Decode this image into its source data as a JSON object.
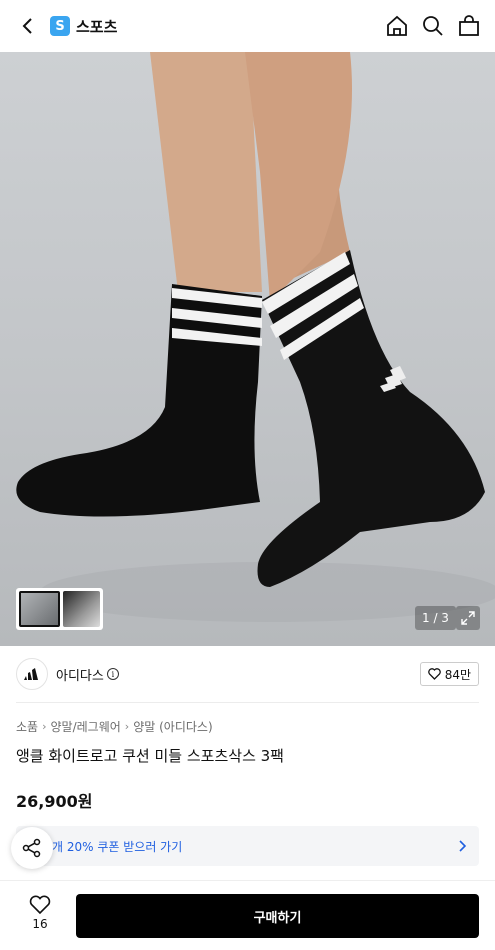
{
  "header": {
    "store_badge": "S",
    "store_name": "스포츠"
  },
  "gallery": {
    "counter": "1 / 3"
  },
  "brand": {
    "name": "아디다스",
    "info_glyph": "i",
    "likes": "84만"
  },
  "breadcrumb": [
    "소품",
    "양말/레그웨어",
    "양말 (아디다스)"
  ],
  "product": {
    "title": "앵클 화이트로고 쿠션 미들 스포츠삭스 3팩",
    "price": "26,900원"
  },
  "coupon": {
    "text": "개 20% 쿠폰 받으러 가기"
  },
  "bottom": {
    "wish_count": "16",
    "buy_label": "구매하기"
  },
  "colors": {
    "coupon_text": "#1f5fe0",
    "store_badge": "#3aa5f0",
    "buy_button": "#000000"
  }
}
